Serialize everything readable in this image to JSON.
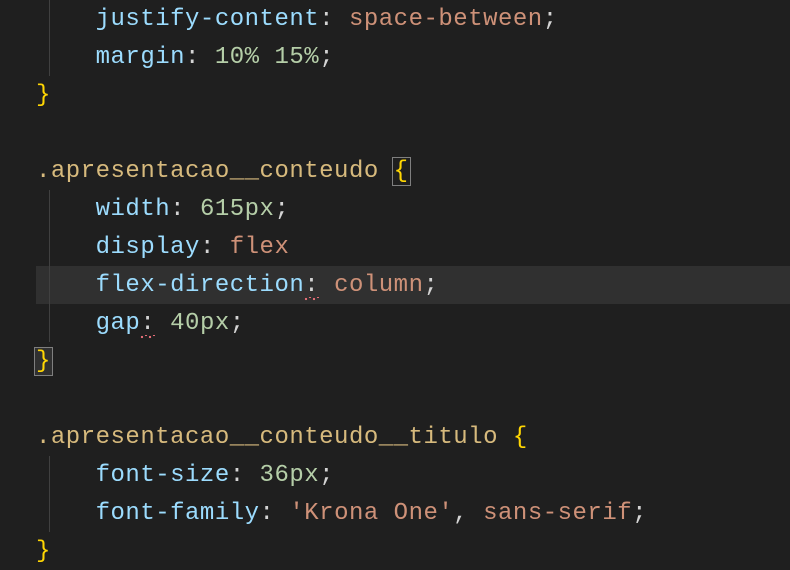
{
  "code": {
    "rule1": {
      "prop1": "justify-content",
      "val1": "space-between",
      "prop2": "margin",
      "val2a": "10%",
      "val2b": "15%"
    },
    "rule2": {
      "selector": ".apresentacao__conteudo",
      "prop1": "width",
      "val1": "615px",
      "prop2": "display",
      "val2": "flex",
      "prop3": "flex-direction",
      "val3": "column",
      "prop4": "gap",
      "val4": "40px"
    },
    "rule3": {
      "selector": ".apresentacao__conteudo__titulo",
      "prop1": "font-size",
      "val1": "36px",
      "prop2": "font-family",
      "val2a": "'Krona One'",
      "val2b": "sans-serif"
    },
    "punct": {
      "colon": ":",
      "semicolon": ";",
      "comma": ",",
      "lbrace": "{",
      "rbrace": "}",
      "space": " ",
      "indent": "    "
    }
  }
}
